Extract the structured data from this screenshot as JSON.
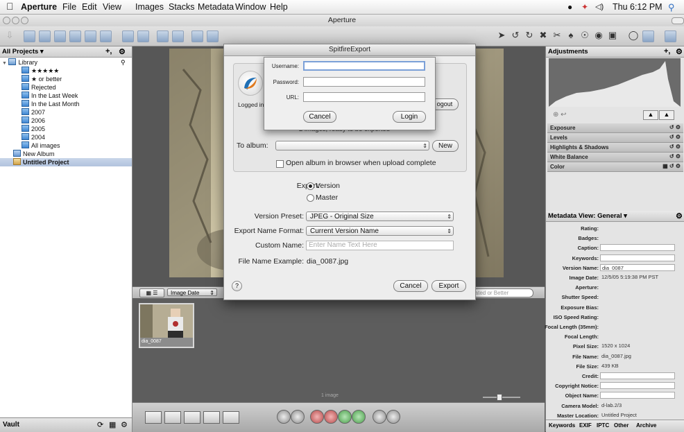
{
  "menubar": {
    "app": "Aperture",
    "items": [
      "File",
      "Edit",
      "View",
      "Images",
      "Stacks",
      "Metadata",
      "Window",
      "Help"
    ],
    "clock": "Thu 6:12 PM"
  },
  "window": {
    "title": "Aperture"
  },
  "projects": {
    "header": "All Projects",
    "header_arrow": "▾",
    "library": "Library",
    "items": [
      "★★★★★",
      "★ or better",
      "Rejected",
      "In the Last Week",
      "In the Last Month",
      "2007",
      "2006",
      "2005",
      "2004",
      "All images"
    ],
    "new_album": "New Album",
    "untitled_project": "Untitled Project",
    "vault": "Vault"
  },
  "browser": {
    "sort_label": "Image Date",
    "filter_text": "rated or Better",
    "thumb_caption": "dia_0087",
    "count_label": "1 image"
  },
  "adjustments": {
    "header": "Adjustments",
    "rows": [
      "Exposure",
      "Levels",
      "Highlights & Shadows",
      "White Balance",
      "Color"
    ]
  },
  "metadata": {
    "header": "Metadata View: General",
    "fields": [
      {
        "label": "Rating:",
        "value": "",
        "boxed": false
      },
      {
        "label": "Badges:",
        "value": "",
        "boxed": false
      },
      {
        "label": "Caption:",
        "value": "",
        "boxed": true
      },
      {
        "label": "Keywords:",
        "value": "",
        "boxed": true
      },
      {
        "label": "Version Name:",
        "value": "dia_0087",
        "boxed": true
      },
      {
        "label": "Image Date:",
        "value": "12/5/05 5:19:38 PM PST",
        "boxed": false
      },
      {
        "label": "Aperture:",
        "value": "",
        "boxed": false
      },
      {
        "label": "Shutter Speed:",
        "value": "",
        "boxed": false
      },
      {
        "label": "Exposure Bias:",
        "value": "",
        "boxed": false
      },
      {
        "label": "ISO Speed Rating:",
        "value": "",
        "boxed": false
      },
      {
        "label": "Focal Length (35mm):",
        "value": "",
        "boxed": false
      },
      {
        "label": "Focal Length:",
        "value": "",
        "boxed": false
      },
      {
        "label": "Pixel Size:",
        "value": "1520 x 1024",
        "boxed": false
      },
      {
        "label": "File Name:",
        "value": "dia_0087.jpg",
        "boxed": false
      },
      {
        "label": "File Size:",
        "value": "439 KB",
        "boxed": false
      },
      {
        "label": "Credit:",
        "value": "",
        "boxed": true
      },
      {
        "label": "Copyright Notice:",
        "value": "",
        "boxed": true
      },
      {
        "label": "Object Name:",
        "value": "",
        "boxed": true
      },
      {
        "label": "Camera Model:",
        "value": "d-lab.2/3",
        "boxed": false
      },
      {
        "label": "Master Location:",
        "value": "Untitled Project",
        "boxed": false
      }
    ],
    "tabs": [
      "Keywords",
      "EXIF",
      "IPTC",
      "Other",
      "Archive"
    ]
  },
  "dialog": {
    "title": "SpitfireExport",
    "logged_in_label": "Logged in a",
    "logout_label": "ogout",
    "ready_text": "2 images, ready to be exported",
    "to_album_label": "To album:",
    "new_button": "New",
    "open_browser_label": "Open album in browser when upload complete",
    "export_label": "Export:",
    "export_version": "Version",
    "export_master": "Master",
    "version_preset_label": "Version Preset:",
    "version_preset_value": "JPEG - Original Size",
    "export_name_label": "Export Name Format:",
    "export_name_value": "Current Version Name",
    "custom_name_label": "Custom Name:",
    "custom_name_placeholder": "Enter Name Text Here",
    "file_example_label": "File Name Example:",
    "file_example_value": "dia_0087.jpg",
    "help": "?",
    "cancel": "Cancel",
    "export": "Export"
  },
  "login": {
    "username_label": "Username:",
    "password_label": "Password:",
    "url_label": "URL:",
    "cancel": "Cancel",
    "login": "Login"
  }
}
